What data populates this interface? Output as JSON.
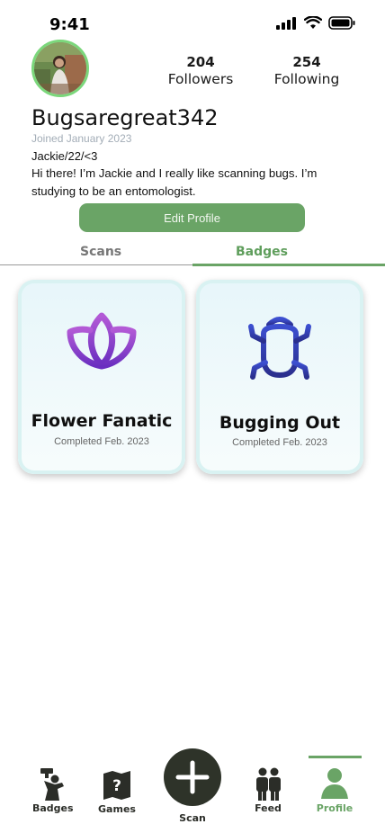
{
  "status_bar": {
    "time": "9:41"
  },
  "profile": {
    "username": "Bugsaregreat342",
    "joined": "Joined January 2023",
    "tagline": "Jackie/22/<3",
    "bio": "Hi there! I’m Jackie and I really like scanning bugs. I’m studying to be an entomologist.",
    "followers_count": "204",
    "followers_label": "Followers",
    "following_count": "254",
    "following_label": "Following",
    "edit_button": "Edit Profile"
  },
  "tabs": [
    {
      "label": "Scans",
      "active": false
    },
    {
      "label": "Badges",
      "active": true
    }
  ],
  "badges": [
    {
      "title": "Flower Fanatic",
      "subtitle": "Completed Feb. 2023",
      "icon": "lotus-icon"
    },
    {
      "title": "Bugging Out",
      "subtitle": "Completed Feb. 2023",
      "icon": "bug-icon"
    }
  ],
  "nav": {
    "items": [
      {
        "label": "Badges",
        "icon": "trophy-person-icon"
      },
      {
        "label": "Games",
        "icon": "map-question-icon"
      },
      {
        "label": "Scan",
        "icon": "plus-icon"
      },
      {
        "label": "Feed",
        "icon": "people-icon"
      },
      {
        "label": "Profile",
        "icon": "person-icon",
        "active": true
      }
    ]
  },
  "colors": {
    "accent_green": "#6aa466",
    "avatar_ring": "#7bd77b",
    "nav_dark": "#2e3329",
    "card_bg": "#e7f6fa"
  }
}
